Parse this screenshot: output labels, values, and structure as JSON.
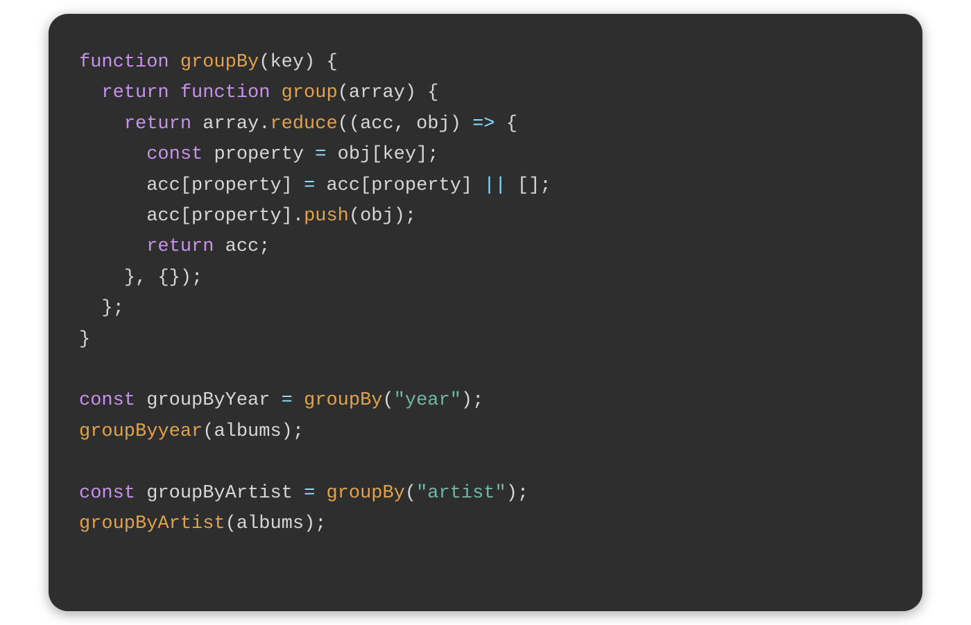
{
  "code": {
    "kw_function": "function",
    "kw_return": "return",
    "kw_const": "const",
    "fn_groupBy": "groupBy",
    "fn_group": "group",
    "fn_reduce": "reduce",
    "fn_push": "push",
    "fn_groupByyear_call": "groupByyear",
    "fn_groupByArtist_call": "groupByArtist",
    "id_key": "key",
    "id_array": "array",
    "id_acc": "acc",
    "id_obj": "obj",
    "id_property": "property",
    "id_groupByYear": "groupByYear",
    "id_groupByArtist": "groupByArtist",
    "id_albums": "albums",
    "str_year": "\"year\"",
    "str_artist": "\"artist\"",
    "p_open_paren": "(",
    "p_close_paren": ")",
    "p_open_brace": "{",
    "p_close_brace": "}",
    "p_open_bracket": "[",
    "p_close_bracket": "]",
    "p_empty_brackets": "[]",
    "p_empty_braces": "{}",
    "p_semicolon": ";",
    "p_comma": ",",
    "p_dot": ".",
    "op_eq": "=",
    "op_arrow": "=>",
    "op_or": "||"
  }
}
